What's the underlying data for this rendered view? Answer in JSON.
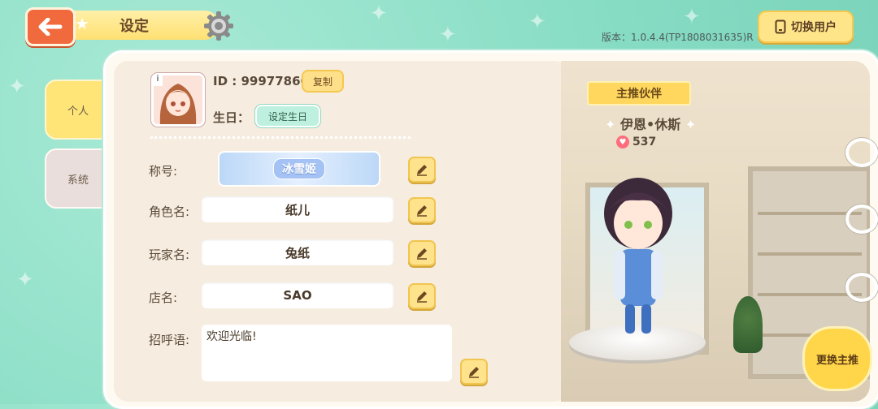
{
  "header": {
    "title": "设定",
    "version": "版本：1.0.4.4(TP1808031635)R",
    "switch_user_label": "切换用户"
  },
  "tabs": [
    {
      "label": "个人",
      "active": true
    },
    {
      "label": "系统",
      "active": false
    }
  ],
  "profile": {
    "id_text": "ID : 99977866",
    "copy_label": "复制",
    "birthday_label": "生日：",
    "set_birthday_label": "设定生日"
  },
  "fields": {
    "title_label": "称号:",
    "title_banner_text": "冰雪姬",
    "role_name_label": "角色名:",
    "role_name_value": "纸儿",
    "player_name_label": "玩家名:",
    "player_name_value": "兔纸",
    "shop_name_label": "店名:",
    "shop_name_value": "SAO",
    "greeting_label": "招呼语:",
    "greeting_value": "欢迎光临!"
  },
  "partner": {
    "ribbon_label": "主推伙伴",
    "name": "伊恩•休斯",
    "likes": "537",
    "change_label": "更换主推"
  },
  "colors": {
    "accent_yellow": "#ffe38c",
    "back_orange": "#f06a3d",
    "background_mint": "#86dcc3"
  }
}
